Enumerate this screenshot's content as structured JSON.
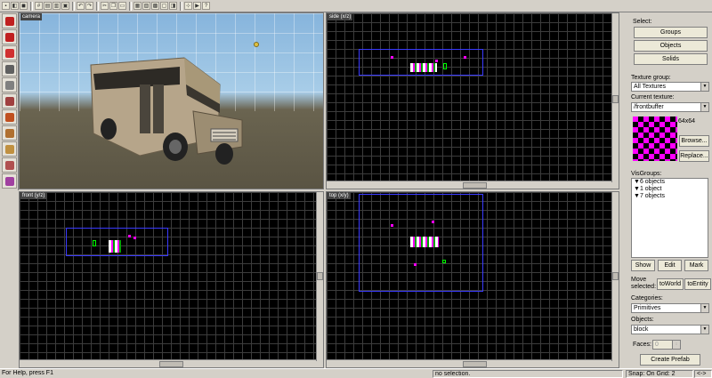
{
  "toolbar": {
    "icons": [
      "new-icon",
      "open-icon",
      "save-icon",
      "grid-icon",
      "grid-smaller-icon",
      "grid-larger-icon",
      "texture-lock-icon",
      "undo-icon",
      "redo-icon",
      "cut-icon",
      "copy-icon",
      "paste-icon",
      "group-icon",
      "ungroup-icon",
      "carve-icon",
      "hollow-icon",
      "toggle-icon",
      "select-icon",
      "run-map-icon",
      "help-icon"
    ]
  },
  "tools": {
    "icons": [
      "select-tool-icon",
      "magnify-tool-icon",
      "camera-tool-icon",
      "entity-tool-icon",
      "block-tool-icon",
      "texture-tool-icon",
      "apply-texture-icon",
      "decal-tool-icon",
      "clipping-tool-icon",
      "vertex-tool-icon",
      "path-tool-icon"
    ]
  },
  "views": {
    "camera_label": "camera",
    "side_label": "side (x/z)",
    "front_label": "front (y/z)",
    "top_label": "top (x/y)"
  },
  "panel": {
    "select_label": "Select:",
    "groups_btn": "Groups",
    "objects_btn": "Objects",
    "solids_btn": "Solids",
    "texture_group_label": "Texture group:",
    "texture_group_value": "All Textures",
    "current_texture_label": "Current texture:",
    "current_texture_value": "/frontbuffer",
    "texture_size": "64x64",
    "browse_btn": "Browse...",
    "replace_btn": "Replace...",
    "visgroups_label": "VisGroups:",
    "visgroups": [
      "6 objects",
      "1 object",
      "7 objects"
    ],
    "show_btn": "Show",
    "edit_btn": "Edit",
    "mark_btn": "Mark",
    "move_selected_label": "Move selected:",
    "to_world_btn": "toWorld",
    "to_entity_btn": "toEntity",
    "categories_label": "Categories:",
    "categories_value": "Primitives",
    "objects_label": "Objects:",
    "objects_value": "block",
    "faces_label": "Faces:",
    "faces_value": "0",
    "create_prefab_btn": "Create Prefab"
  },
  "status": {
    "help": "For Help, press F1",
    "selection": "no selection.",
    "snap": "Snap: On Grid: 2",
    "scroll_arrows": "<->"
  }
}
